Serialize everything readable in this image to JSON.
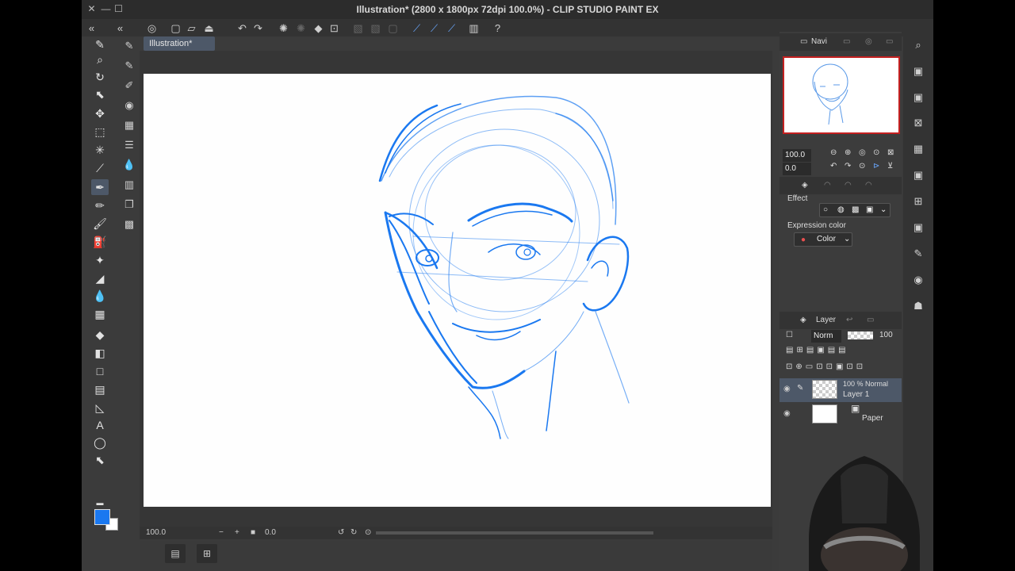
{
  "window": {
    "title": "Illustration* (2800 x 1800px 72dpi 100.0%)  - CLIP STUDIO PAINT EX",
    "close": "✕",
    "minimize": "—",
    "maximize": "☐"
  },
  "document_tab": {
    "label": "Illustration*"
  },
  "status": {
    "zoom": "100.0",
    "rotation": "0.0"
  },
  "navigator": {
    "tab_label": "Navi",
    "zoom_value": "100.0",
    "rotate_value": "0.0"
  },
  "tool_property": {
    "effect_label": "Effect",
    "expression_label": "Expression color",
    "expression_value": "Color"
  },
  "layer_panel": {
    "tab_label": "Layer",
    "blend_mode": "Norm",
    "opacity": "100",
    "layers": [
      {
        "opacity_mode": "100 % Normal",
        "name": "Layer 1"
      },
      {
        "name": "Paper"
      }
    ]
  },
  "colors": {
    "main": "#1a78f0",
    "sub": "#ffffff",
    "accent": "#4d5868",
    "sketch": "#1a78f0"
  }
}
